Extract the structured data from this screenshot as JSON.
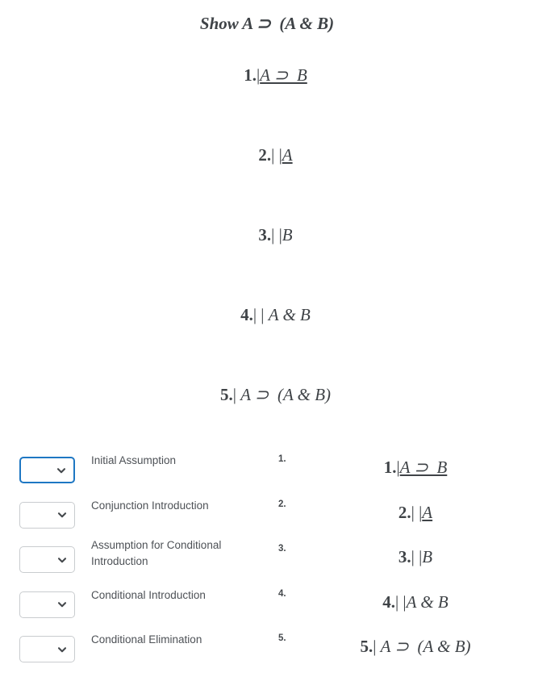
{
  "proof": {
    "goal": "Show A ⊃  (A & B)",
    "lines": [
      {
        "num": "1.",
        "bars": "|",
        "formula": "A ⊃  B",
        "underlined": true
      },
      {
        "num": "2.",
        "bars": "| |",
        "formula": "A",
        "underlined": true
      },
      {
        "num": "3.",
        "bars": "| |",
        "formula": "B",
        "underlined": false
      },
      {
        "num": "4.",
        "bars": "| | ",
        "formula": "A & B",
        "underlined": false
      },
      {
        "num": "5.",
        "bars": "| ",
        "formula": "A ⊃  (A & B)",
        "underlined": false
      }
    ]
  },
  "work_rows": [
    {
      "row_number": "1.",
      "rule_label": "Initial Assumption",
      "select_value": "",
      "select_placeholder": "",
      "focused": true,
      "formula_num": "1.",
      "formula_bars": "|",
      "formula": "A ⊃  B",
      "underlined": true
    },
    {
      "row_number": "2.",
      "rule_label": "Conjunction Introduction",
      "select_value": "",
      "select_placeholder": "",
      "focused": false,
      "formula_num": "2.",
      "formula_bars": "| |",
      "formula": "A",
      "underlined": true
    },
    {
      "row_number": "3.",
      "rule_label": "Assumption for Conditional Introduction",
      "select_value": "",
      "select_placeholder": "",
      "focused": false,
      "formula_num": "3.",
      "formula_bars": "| |",
      "formula": "B",
      "underlined": false
    },
    {
      "row_number": "4.",
      "rule_label": "Conditional Introduction",
      "select_value": "",
      "select_placeholder": "",
      "focused": false,
      "formula_num": "4.",
      "formula_bars": "| |",
      "formula": "A & B",
      "underlined": false
    },
    {
      "row_number": "5.",
      "rule_label": "Conditional Elimination",
      "select_value": "",
      "select_placeholder": "",
      "focused": false,
      "formula_num": "5.",
      "formula_bars": "| ",
      "formula": "A ⊃  (A & B)",
      "underlined": false
    }
  ],
  "icons": {
    "dropdown": "chevron-down-icon"
  },
  "colors": {
    "focus_border": "#1e77c3",
    "idle_border": "#c9cccf",
    "text": "#4d5156",
    "formula_text": "#3f4347"
  }
}
